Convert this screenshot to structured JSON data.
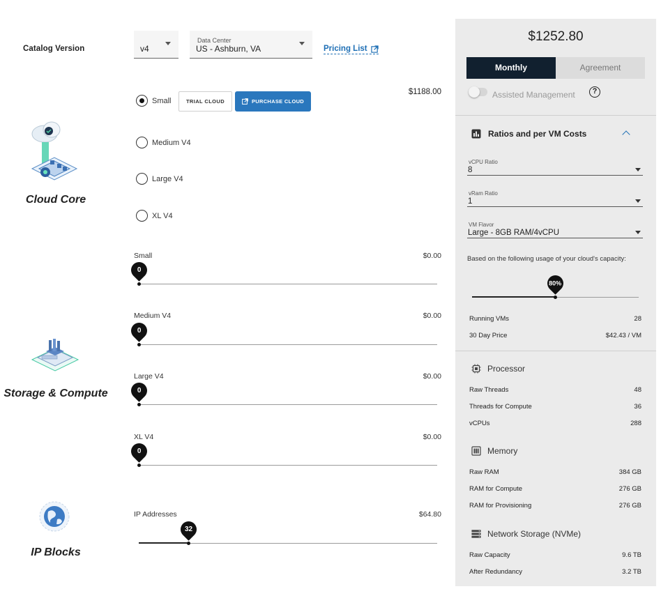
{
  "catalog": {
    "label": "Catalog Version",
    "version": "v4"
  },
  "data_center": {
    "label": "Data Center",
    "value": "US - Ashburn, VA"
  },
  "pricing_link": "Pricing List",
  "sections": {
    "cloud_core": "Cloud Core",
    "storage_compute": "Storage & Compute",
    "ip_blocks": "IP Blocks"
  },
  "cloud_core": {
    "price": "$1188.00",
    "options": [
      {
        "label": "Small",
        "checked": true
      },
      {
        "label": "Medium V4",
        "checked": false
      },
      {
        "label": "Large V4",
        "checked": false
      },
      {
        "label": "XL V4",
        "checked": false
      }
    ],
    "trial_button": "TRIAL CLOUD",
    "purchase_button": "PURCHASE CLOUD"
  },
  "storage_compute": [
    {
      "label": "Small",
      "price": "$0.00",
      "value": "0",
      "fraction": 0
    },
    {
      "label": "Medium V4",
      "price": "$0.00",
      "value": "0",
      "fraction": 0
    },
    {
      "label": "Large V4",
      "price": "$0.00",
      "value": "0",
      "fraction": 0
    },
    {
      "label": "XL V4",
      "price": "$0.00",
      "value": "0",
      "fraction": 0
    }
  ],
  "ip_blocks": {
    "label": "IP Addresses",
    "price": "$64.80",
    "value": "32",
    "fraction": 0.168
  },
  "summary": {
    "total": "$1252.80",
    "tab_monthly": "Monthly",
    "tab_agreement": "Agreement",
    "assisted_label": "Assisted Management",
    "assisted_enabled": false,
    "help_glyph": "?"
  },
  "ratios": {
    "title": "Ratios and per VM Costs",
    "vcpu_ratio": {
      "label": "vCPU Ratio",
      "value": "8"
    },
    "vram_ratio": {
      "label": "vRam Ratio",
      "value": "1"
    },
    "vm_flavor": {
      "label": "VM Flavor",
      "value": "Large - 8GB RAM/4vCPU"
    },
    "usage_text": "Based on the following usage of your cloud's capacity:",
    "usage_value": "80%",
    "usage_fraction": 0.5,
    "running_vms": {
      "label": "Running VMs",
      "value": "28"
    },
    "day_price": {
      "label": "30 Day Price",
      "value": "$42.43 / VM"
    }
  },
  "processor": {
    "title": "Processor",
    "rows": [
      {
        "label": "Raw Threads",
        "value": "48"
      },
      {
        "label": "Threads for Compute",
        "value": "36"
      },
      {
        "label": "vCPUs",
        "value": "288"
      }
    ]
  },
  "memory": {
    "title": "Memory",
    "rows": [
      {
        "label": "Raw RAM",
        "value": "384 GB"
      },
      {
        "label": "RAM for Compute",
        "value": "276 GB"
      },
      {
        "label": "RAM for Provisioning",
        "value": "276 GB"
      }
    ]
  },
  "storage": {
    "title": "Network Storage (NVMe)",
    "rows": [
      {
        "label": "Raw Capacity",
        "value": "9.6 TB"
      },
      {
        "label": "After Redundancy",
        "value": "3.2 TB"
      }
    ]
  },
  "colors": {
    "accent": "#2a77bd",
    "dark_tab": "#11202f",
    "panel": "#ebebeb"
  }
}
